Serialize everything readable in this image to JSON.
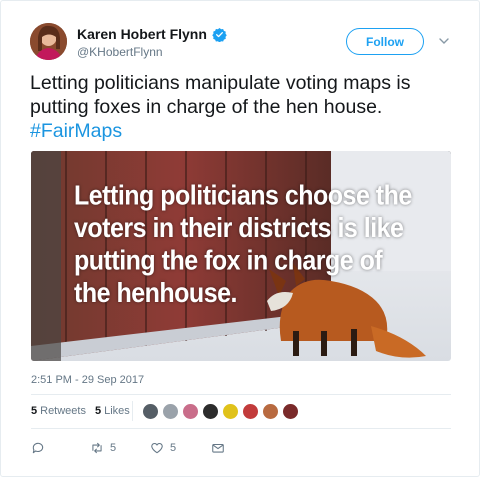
{
  "author": {
    "name": "Karen Hobert Flynn",
    "handle": "@KHobertFlynn",
    "verified": true
  },
  "follow_label": "Follow",
  "tweet": {
    "text": "Letting politicians manipulate voting maps is putting foxes in charge of the hen house.",
    "hashtag": "#FairMaps"
  },
  "media": {
    "caption": "Letting politicians choose the voters in their districts is like putting the fox in charge of the henhouse."
  },
  "timestamp": "2:51 PM - 29 Sep 2017",
  "stats": {
    "retweets_count": "5",
    "retweets_label": "Retweets",
    "likes_count": "5",
    "likes_label": "Likes"
  },
  "actions": {
    "reply_count": "",
    "retweet_count": "5",
    "like_count": "5"
  },
  "colors": {
    "accent": "#1da1f2",
    "hashtag": "#1b95e0",
    "muted": "#657786"
  }
}
